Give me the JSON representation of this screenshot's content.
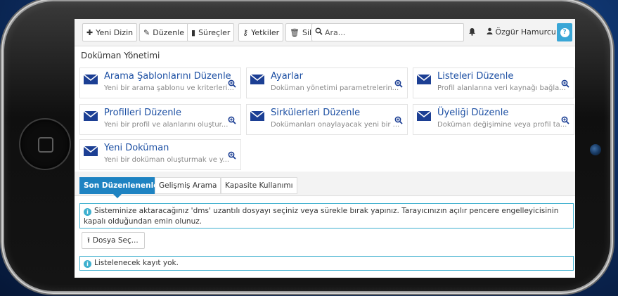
{
  "toolbar": {
    "new_folder": {
      "icon": "plus-icon",
      "label": "Yeni Dizin"
    },
    "edit": {
      "icon": "pencil-icon",
      "label": "Düzenle"
    },
    "processes": {
      "icon": "book-icon",
      "label": "Süreçler"
    },
    "permissions": {
      "icon": "key-icon",
      "label": "Yetkiler"
    },
    "delete": {
      "icon": "trash-icon",
      "label": "Sil"
    },
    "search_placeholder": "Ara...",
    "notification_icon": "bell-icon",
    "user_icon": "user-icon",
    "user_name": "Özgür Hamurcu",
    "help_icon": "question-icon",
    "accent_color": "#39a6d6"
  },
  "section": {
    "title": "Doküman Yönetimi"
  },
  "cards": [
    {
      "title": "Arama Şablonlarını Düzenle",
      "desc": "Yeni bir arama şablonu ve kriterleri..."
    },
    {
      "title": "Ayarlar",
      "desc": "Doküman yönetimi parametrelerin..."
    },
    {
      "title": "Listeleri Düzenle",
      "desc": "Profil alanlarına veri kaynağı bağla..."
    },
    {
      "title": "Profilleri Düzenle",
      "desc": "Yeni bir profil ve alanlarını oluştur..."
    },
    {
      "title": "Sirkülerleri Düzenle",
      "desc": "Dokümanları onaylayacak yeni bir ..."
    },
    {
      "title": "Üyeliği Düzenle",
      "desc": "Doküman değişimine veya profil ta..."
    },
    {
      "title": "Yeni Doküman",
      "desc": "Yeni bir doküman oluşturmak ve y..."
    }
  ],
  "card_colors": {
    "title": "#1c4fa3",
    "icon": "#1c3f94"
  },
  "tabs": [
    {
      "label": "Son Düzenlenenler",
      "active": true
    },
    {
      "label": "Gelişmiş Arama",
      "active": false
    },
    {
      "label": "Kapasite Kullanımı",
      "active": false
    }
  ],
  "tab_active_color": "#1e83c2",
  "upload_info": "Sisteminize aktaracağınız 'dms' uzantılı dosyayı seçiniz veya sürekle bırak yapınız. Tarayıcınızın açılır pencere engelleyicisinin kapalı olduğundan emin olunuz.",
  "file_button": {
    "icon": "upload-icon",
    "label": "Dosya Seç..."
  },
  "empty_info": "Listelenecek kayıt yok.",
  "info_color": "#3fb0cf"
}
